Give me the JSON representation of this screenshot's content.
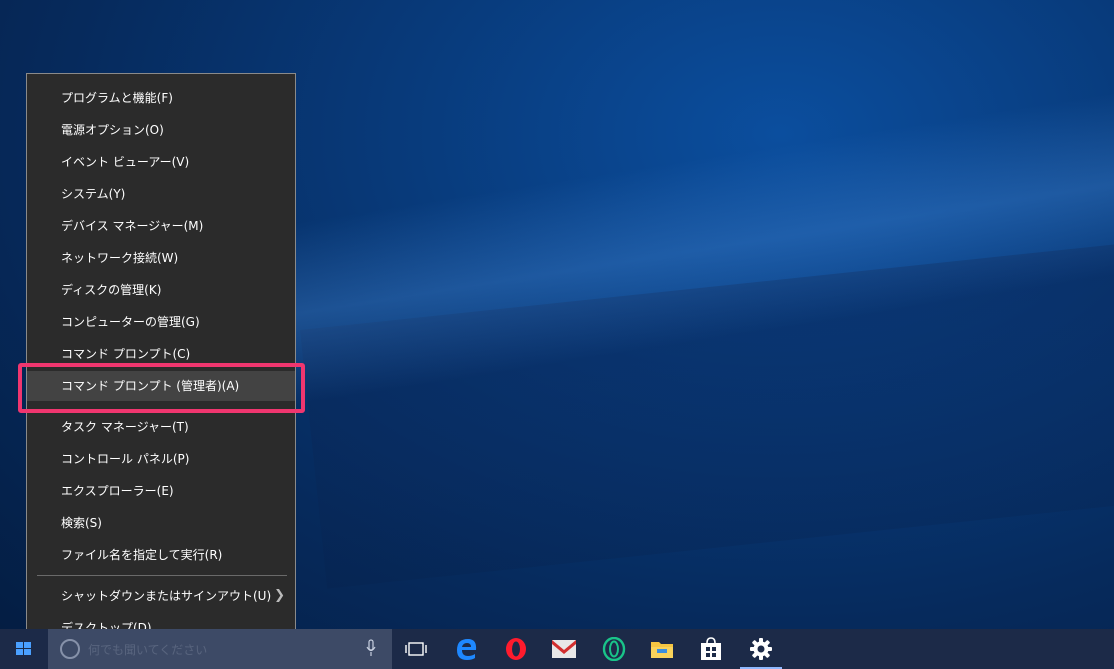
{
  "context_menu": {
    "items": [
      {
        "label": "プログラムと機能(F)"
      },
      {
        "label": "電源オプション(O)"
      },
      {
        "label": "イベント ビューアー(V)"
      },
      {
        "label": "システム(Y)"
      },
      {
        "label": "デバイス マネージャー(M)"
      },
      {
        "label": "ネットワーク接続(W)"
      },
      {
        "label": "ディスクの管理(K)"
      },
      {
        "label": "コンピューターの管理(G)"
      },
      {
        "label": "コマンド プロンプト(C)"
      },
      {
        "label": "コマンド プロンプト (管理者)(A)",
        "highlighted": true
      },
      {
        "label": "タスク マネージャー(T)"
      },
      {
        "label": "コントロール パネル(P)"
      },
      {
        "label": "エクスプローラー(E)"
      },
      {
        "label": "検索(S)"
      },
      {
        "label": "ファイル名を指定して実行(R)"
      },
      {
        "label": "シャットダウンまたはサインアウト(U)",
        "has_submenu": true
      },
      {
        "label": "デスクトップ(D)"
      }
    ]
  },
  "taskbar": {
    "search_placeholder": "何でも聞いてください",
    "pinned_apps": [
      "task-view",
      "edge",
      "opera",
      "mail",
      "opera-neon",
      "file-explorer",
      "store",
      "settings"
    ],
    "active_app": "settings"
  },
  "colors": {
    "menu_bg": "#2b2b2b",
    "highlight_bg": "#434343",
    "callout_border": "#f0366f",
    "taskbar_bg": "#1c2a48",
    "accent": "#4aa0ff"
  }
}
